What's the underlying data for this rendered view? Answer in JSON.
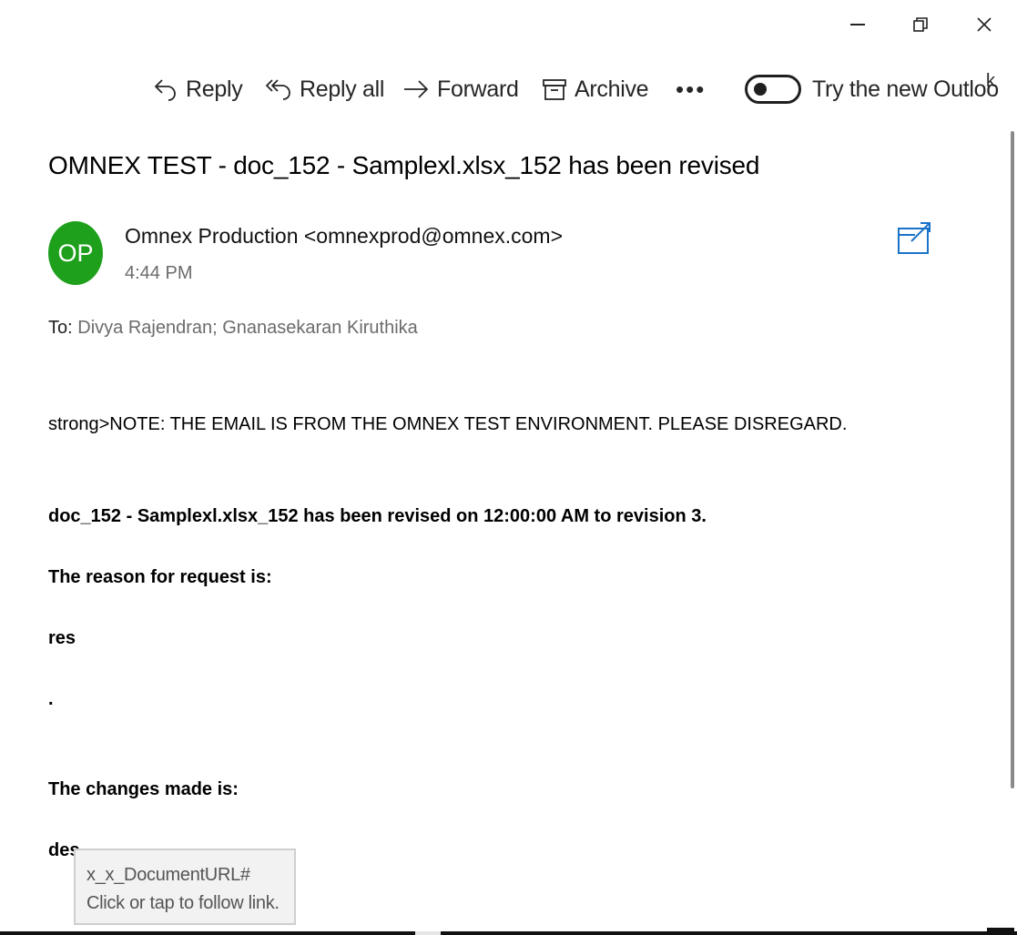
{
  "toolbar": {
    "reply_label": "Reply",
    "reply_all_label": "Reply all",
    "forward_label": "Forward",
    "archive_label": "Archive",
    "more_label": "•••",
    "try_new_outlook_label": "Try the new Outloo",
    "try_new_outlook_suffix": "k"
  },
  "message": {
    "subject": "OMNEX TEST - doc_152 - Samplexl.xlsx_152 has been revised",
    "avatar_initials": "OP",
    "avatar_color": "#1ea01c",
    "sender": "Omnex Production <omnexprod@omnex.com>",
    "time": "4:44 PM",
    "to_label": "To:",
    "to_names": "Divya Rajendran; Gnanasekaran Kiruthika"
  },
  "body": {
    "note": "strong>NOTE: THE EMAIL IS FROM THE OMNEX TEST ENVIRONMENT.  PLEASE DISREGARD.",
    "revision_line": "doc_152 - Samplexl.xlsx_152 has been revised on 12:00:00 AM to revision 3.",
    "reason_heading": "The reason for request is:",
    "reason_value": "res",
    "dot": ".",
    "changes_heading": "The changes made is:",
    "changes_value": "des"
  },
  "tooltip": {
    "link_text": "x_x_DocumentURL#",
    "hint": "Click or tap to follow link."
  }
}
